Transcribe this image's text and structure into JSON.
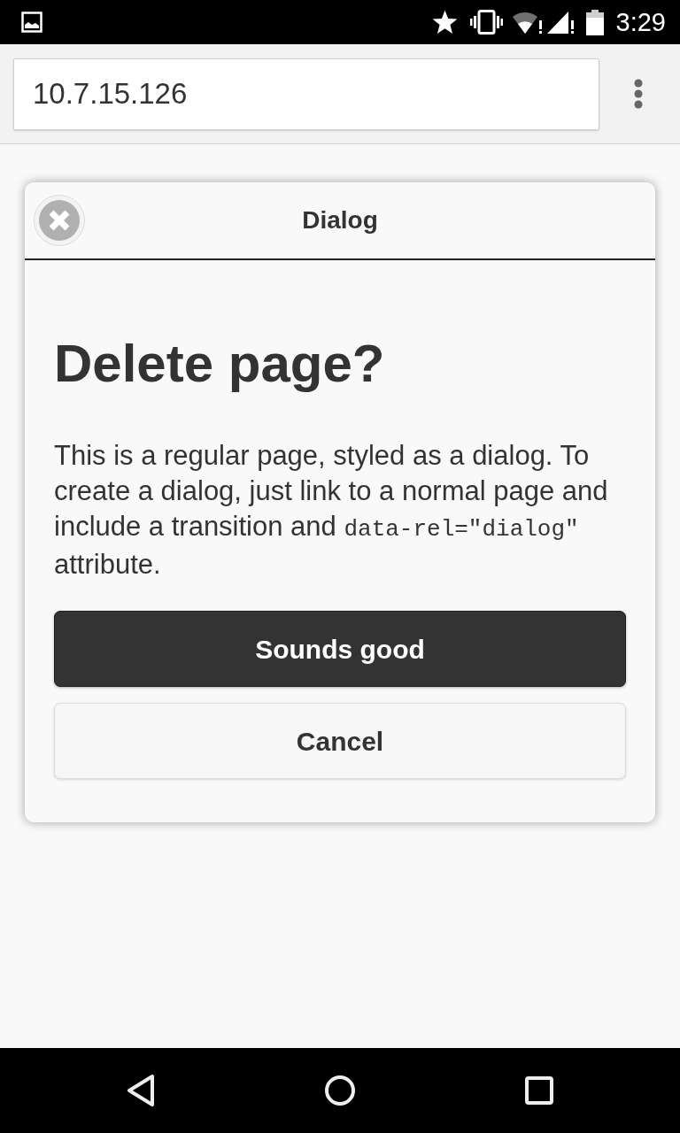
{
  "status_bar": {
    "time": "3:29"
  },
  "address_bar": {
    "url": "10.7.15.126"
  },
  "dialog": {
    "title": "Dialog",
    "heading": "Delete page?",
    "message": [
      {
        "kind": "text",
        "text": "This is a regular page, styled as a dialog. To create a dialog, just link to a normal page and include a transition and "
      },
      {
        "kind": "code",
        "text": "data-rel=\"dialog\""
      },
      {
        "kind": "text",
        "text": " attribute."
      }
    ],
    "buttons": [
      {
        "label": "Sounds good",
        "kind": "primary"
      },
      {
        "label": "Cancel",
        "kind": "secondary"
      }
    ]
  }
}
